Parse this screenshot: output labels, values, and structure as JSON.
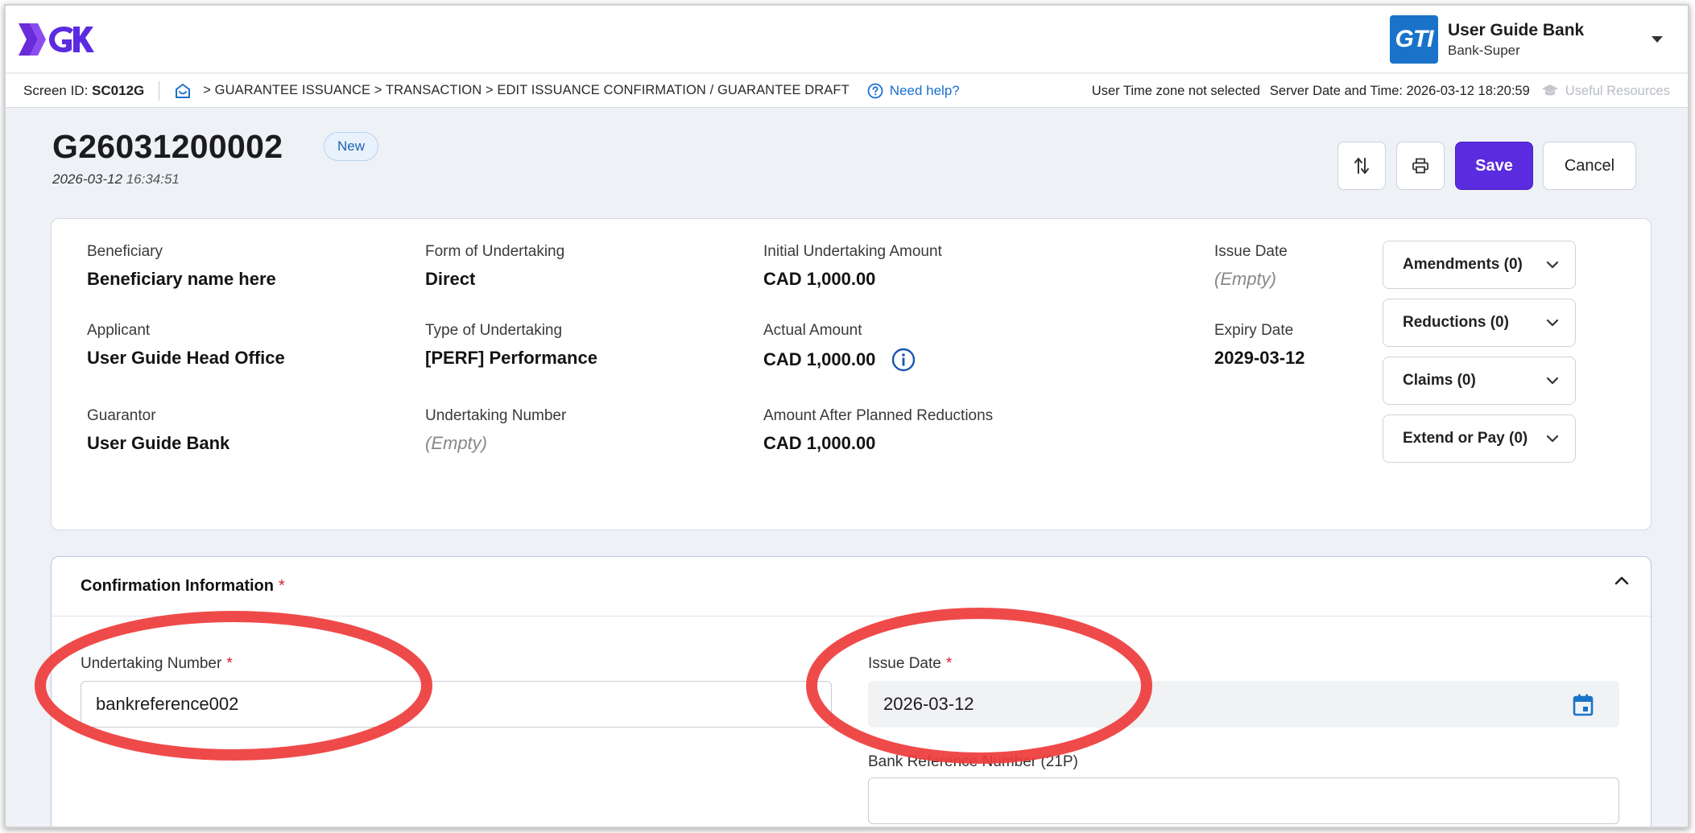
{
  "app": {
    "logo_text": "GTK",
    "user_name": "User Guide Bank",
    "user_role": "Bank-Super",
    "user_logo_text": "GTI"
  },
  "crumbbar": {
    "screen_id_label": "Screen ID:",
    "screen_id_value": "SC012G",
    "path": "> GUARANTEE ISSUANCE > TRANSACTION > EDIT ISSUANCE CONFIRMATION / GUARANTEE DRAFT",
    "help": "Need help?",
    "timezone": "User Time zone not selected",
    "server_time": "Server Date and Time: 2026-03-12 18:20:59",
    "useful_resources": "Useful Resources"
  },
  "header": {
    "title": "G26031200002",
    "status": "New",
    "date": "2026-03-12",
    "time": "16:34:51",
    "save_label": "Save",
    "cancel_label": "Cancel"
  },
  "summary": {
    "beneficiary": {
      "label": "Beneficiary",
      "value": "Beneficiary name here"
    },
    "applicant": {
      "label": "Applicant",
      "value": "User Guide Head Office"
    },
    "guarantor": {
      "label": "Guarantor",
      "value": "User Guide Bank"
    },
    "form": {
      "label": "Form of Undertaking",
      "value": "Direct"
    },
    "type": {
      "label": "Type of Undertaking",
      "value": "[PERF] Performance"
    },
    "undertaking_number": {
      "label": "Undertaking Number",
      "value": "(Empty)"
    },
    "initial_amount": {
      "label": "Initial Undertaking Amount",
      "value": "CAD 1,000.00"
    },
    "actual_amount": {
      "label": "Actual Amount",
      "value": "CAD 1,000.00"
    },
    "after_reductions": {
      "label": "Amount After Planned Reductions",
      "value": "CAD 1,000.00"
    },
    "issue_date": {
      "label": "Issue Date",
      "value": "(Empty)"
    },
    "expiry_date": {
      "label": "Expiry Date",
      "value": "2029-03-12"
    }
  },
  "accordions": [
    {
      "label": "Amendments (0)"
    },
    {
      "label": "Reductions (0)"
    },
    {
      "label": "Claims (0)"
    },
    {
      "label": "Extend or Pay (0)"
    }
  ],
  "confirmation": {
    "title": "Confirmation Information",
    "required_mark": "*",
    "undertaking_number_label": "Undertaking Number",
    "undertaking_number_value": "bankreference002",
    "issue_date_label": "Issue Date",
    "issue_date_value": "2026-03-12",
    "bank_ref_label": "Bank Reference Number (21P)",
    "bank_ref_value": ""
  },
  "colors": {
    "primary": "#5b2be0",
    "link": "#1a6fd1",
    "required": "#d21f2b",
    "annotation": "#ee3b3b"
  }
}
